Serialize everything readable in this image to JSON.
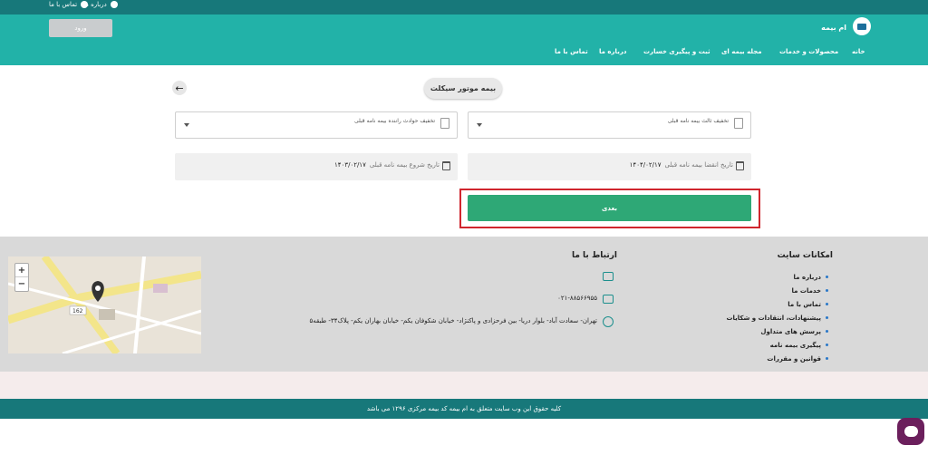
{
  "topbar": {
    "contact_us": "تماس با ما",
    "about_us": "درباره ما"
  },
  "header": {
    "brand": "ام بیمه",
    "login_label": "ورود",
    "nav": [
      "خانه",
      "محصولات و خدمات",
      "مجله بیمه ای",
      "ثبت و پیگیری خسارت",
      "درباره ما",
      "تماس با ما"
    ]
  },
  "form": {
    "page_title": "بیمه موتور سیکلت",
    "select_prev_discount": "تخفیف ثالث بیمه نامه قبلی",
    "select_driver_discount": "تخفیف حوادث راننده بیمه نامه قبلی",
    "expiry_label": "تاریخ انقضا بیمه نامه قبلی",
    "expiry_value": "۱۴۰۴/۰۲/۱۷",
    "start_label": "تاریخ شروع بیمه نامه قبلی",
    "start_value": "۱۴۰۳/۰۲/۱۷",
    "next_label": "بعدی"
  },
  "footer": {
    "contact_heading": "ارتباط با ما",
    "phone": "۰۲۱-۸۸۵۶۶۹۵۵",
    "address": "تهران- سعادت آباد- بلوار دریا- بین فرحزادی و پاکنژاد- خیابان شکوفان یکم- خیابان بهاران یکم- پلاک۳۴- طبقه۵",
    "site_heading": "امکانات سایت",
    "site_links": [
      "درباره ما",
      "خدمات ما",
      "تماس با ما",
      "پیشنهادات، انتقادات و شکایات",
      "پرسش های متداول",
      "پیگیری بیمه نامه",
      "قوانین و مقررات"
    ],
    "map_zoom_in": "+",
    "map_zoom_out": "−",
    "map_label": "162"
  },
  "copyright": "کلیه حقوق این وب سایت متعلق به ام بیمه کد بیمه مرکزی ۱۲۹۶ می باشد",
  "colors": {
    "header": "#22b2a8",
    "topbar": "#17787a",
    "next_button": "#2ea876",
    "highlight": "#d0262e"
  }
}
